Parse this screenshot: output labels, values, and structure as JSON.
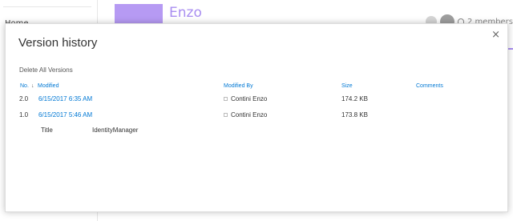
{
  "background": {
    "nav_home": "Home",
    "site_title": "Enzo",
    "members": "2 members"
  },
  "dialog": {
    "title": "Version history",
    "close": "×",
    "delete_all": "Delete All Versions",
    "columns": {
      "no": "No.",
      "sort": "↓",
      "modified": "Modified",
      "modified_by": "Modified By",
      "size": "Size",
      "comments": "Comments"
    },
    "versions": [
      {
        "no": "2.0",
        "modified": "6/15/2017 6:35 AM",
        "modified_by": "Contini Enzo",
        "size": "174.2 KB",
        "comments": ""
      },
      {
        "no": "1.0",
        "modified": "6/15/2017 5:46 AM",
        "modified_by": "Contini Enzo",
        "size": "173.8 KB",
        "comments": ""
      }
    ],
    "property": {
      "label": "Title",
      "value": "IdentityManager"
    }
  },
  "colors": {
    "accent": "#a98ef0",
    "link": "#0078d4"
  }
}
